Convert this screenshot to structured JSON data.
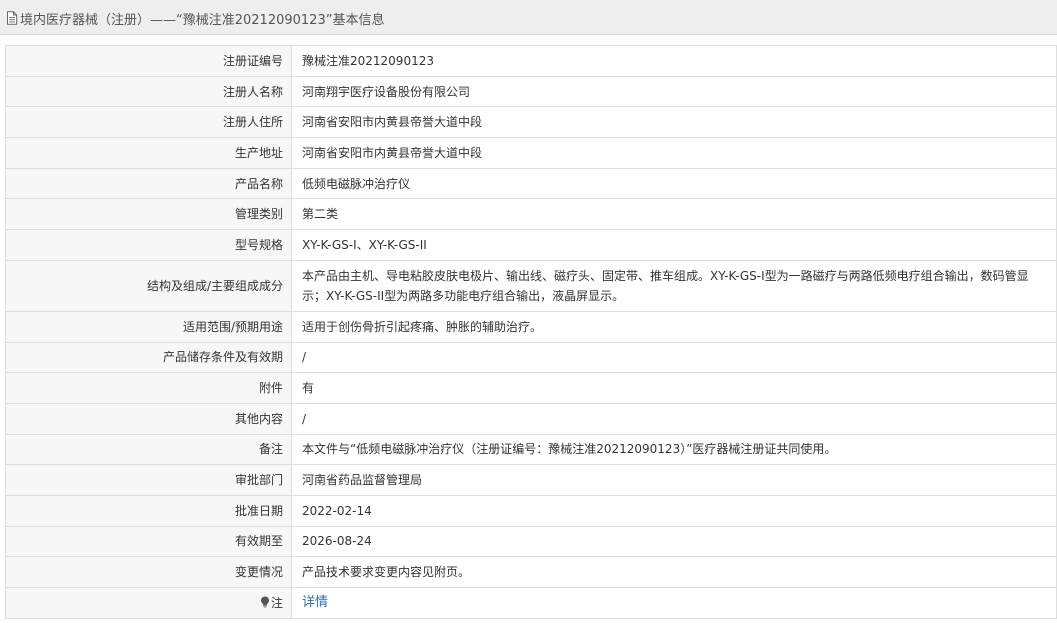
{
  "header": {
    "icon": "document-icon",
    "title": "境内医疗器械（注册）——“豫械注准20212090123”基本信息"
  },
  "rows": [
    {
      "label": "注册证编号",
      "value": "豫械注准20212090123"
    },
    {
      "label": "注册人名称",
      "value": "河南翔宇医疗设备股份有限公司"
    },
    {
      "label": "注册人住所",
      "value": "河南省安阳市内黄县帝誉大道中段"
    },
    {
      "label": "生产地址",
      "value": "河南省安阳市内黄县帝誉大道中段"
    },
    {
      "label": "产品名称",
      "value": "低频电磁脉冲治疗仪"
    },
    {
      "label": "管理类别",
      "value": "第二类"
    },
    {
      "label": "型号规格",
      "value": "XY-K-GS-I、XY-K-GS-II"
    },
    {
      "label": "结构及组成/主要组成成分",
      "value": "本产品由主机、导电粘胶皮肤电极片、输出线、磁疗头、固定带、推车组成。XY-K-GS-I型为一路磁疗与两路低频电疗组合输出，数码管显示；XY-K-GS-II型为两路多功能电疗组合输出，液晶屏显示。"
    },
    {
      "label": "适用范围/预期用途",
      "value": "适用于创伤骨折引起疼痛、肿胀的辅助治疗。"
    },
    {
      "label": "产品储存条件及有效期",
      "value": "/"
    },
    {
      "label": "附件",
      "value": "有"
    },
    {
      "label": "其他内容",
      "value": "/"
    },
    {
      "label": "备注",
      "value": "本文件与“低频电磁脉冲治疗仪（注册证编号：豫械注准20212090123）”医疗器械注册证共同使用。"
    },
    {
      "label": "审批部门",
      "value": "河南省药品监督管理局"
    },
    {
      "label": "批准日期",
      "value": "2022-02-14"
    },
    {
      "label": "有效期至",
      "value": "2026-08-24"
    },
    {
      "label": "变更情况",
      "value": "产品技术要求变更内容见附页。"
    }
  ],
  "note_row": {
    "icon": "lightbulb-icon",
    "label": "注",
    "link_text": "详情",
    "link_color": "#2b6fb6"
  }
}
